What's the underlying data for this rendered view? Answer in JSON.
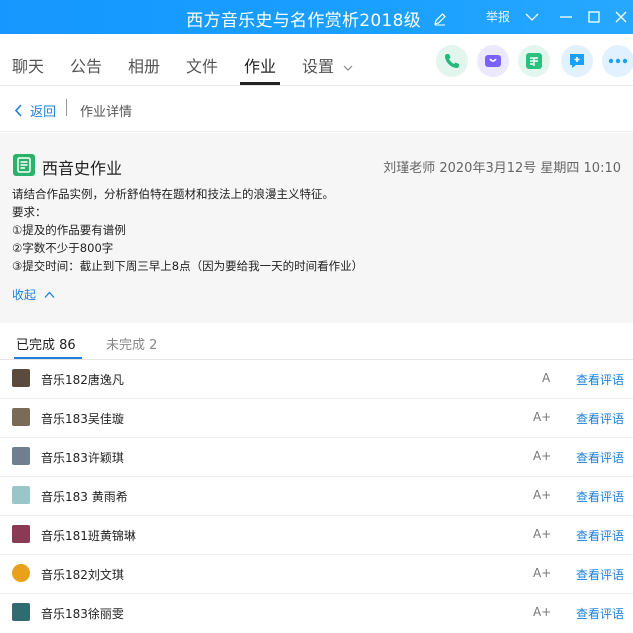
{
  "window": {
    "title": "西方音乐史与名作赏析2018级",
    "report_label": "举报"
  },
  "tabs": [
    "聊天",
    "公告",
    "相册",
    "文件",
    "作业",
    "设置"
  ],
  "active_tab": "作业",
  "breadcrumb": {
    "back": "返回",
    "current": "作业详情"
  },
  "homework": {
    "title": "西音史作业",
    "meta": "刘瑾老师 2020年3月12号 星期四 10:10",
    "lines": [
      "请结合作品实例，分析舒伯特在题材和技法上的浪漫主义特征。",
      "要求：",
      "①提及的作品要有谱例",
      "②字数不少于800字",
      "③提交时间：截止到下周三早上8点（因为要给我一天的时间看作业）"
    ],
    "collapse_label": "收起"
  },
  "status": {
    "done": "已完成 86",
    "undone": "未完成 2"
  },
  "submissions": [
    {
      "name": "音乐182唐逸凡",
      "grade": "A",
      "action": "查看评语",
      "avatar_color": "#5b4a3e"
    },
    {
      "name": "音乐183吴佳璇",
      "grade": "A+",
      "action": "查看评语",
      "avatar_color": "#7a6a58"
    },
    {
      "name": "音乐183许颖琪",
      "grade": "A+",
      "action": "查看评语",
      "avatar_color": "#6f7f8f"
    },
    {
      "name": "音乐183 黄雨希",
      "grade": "A+",
      "action": "查看评语",
      "avatar_color": "#9bc6c8"
    },
    {
      "name": "音乐181班黄锦琳",
      "grade": "A+",
      "action": "查看评语",
      "avatar_color": "#8a3a55"
    },
    {
      "name": "音乐182刘文琪",
      "grade": "A+",
      "action": "查看评语",
      "avatar_color": "#e9a11b"
    },
    {
      "name": "音乐183徐丽雯",
      "grade": "A+",
      "action": "查看评语",
      "avatar_color": "#2f6b70"
    }
  ],
  "colors": {
    "title_bar": "#1a9bff",
    "link": "#1e7fd8",
    "call_green": "#22b97a",
    "video_purple": "#7b61ff",
    "class_green": "#2ac17f",
    "comment_blue": "#1aa0ff"
  }
}
